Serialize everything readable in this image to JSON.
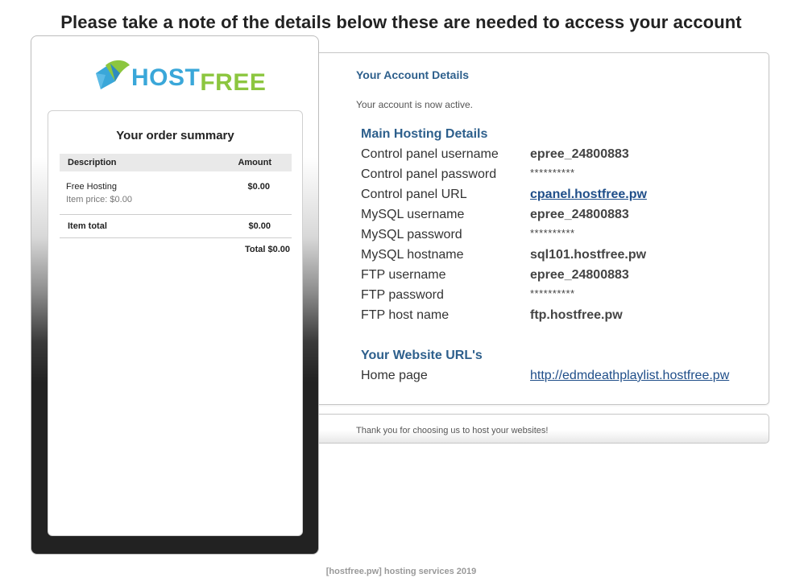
{
  "headline": "Please take a note of the details below these are needed to access your account",
  "logo": {
    "host": "HOST",
    "free": "FREE",
    "icon": "hostfree-leaf-logo-icon",
    "colors": {
      "host": "#3aa7d9",
      "free": "#8cc63f"
    }
  },
  "order_summary": {
    "title": "Your order summary",
    "columns": {
      "description": "Description",
      "amount": "Amount"
    },
    "item": {
      "name": "Free Hosting",
      "price": "Item price: $0.00",
      "amount": "$0.00"
    },
    "item_total": {
      "label": "Item total",
      "amount": "$0.00"
    },
    "grand_total": "Total $0.00"
  },
  "account": {
    "title": "Your Account Details",
    "status": "Your account is now active.",
    "main_section_title": "Main Hosting Details",
    "rows": [
      {
        "label": "Control panel username",
        "value": "epree_24800883"
      },
      {
        "label": "Control panel password",
        "value": "**********"
      },
      {
        "label": "Control panel URL",
        "value": "cpanel.hostfree.pw"
      },
      {
        "label": "MySQL username",
        "value": "epree_24800883"
      },
      {
        "label": "MySQL password",
        "value": "**********"
      },
      {
        "label": "MySQL hostname",
        "value": "sql101.hostfree.pw"
      },
      {
        "label": "FTP username",
        "value": "epree_24800883"
      },
      {
        "label": "FTP password",
        "value": "**********"
      },
      {
        "label": "FTP host name",
        "value": "ftp.hostfree.pw"
      }
    ],
    "website_section_title": "Your Website URL's",
    "website": {
      "label": "Home page",
      "value": "http://edmdeathplaylist.hostfree.pw"
    },
    "colors": {
      "heading": "#2d5f8c",
      "link": "#1f4e89"
    }
  },
  "thanks": "Thank you for choosing us to host your websites!",
  "footer": "[hostfree.pw] hosting services 2019"
}
